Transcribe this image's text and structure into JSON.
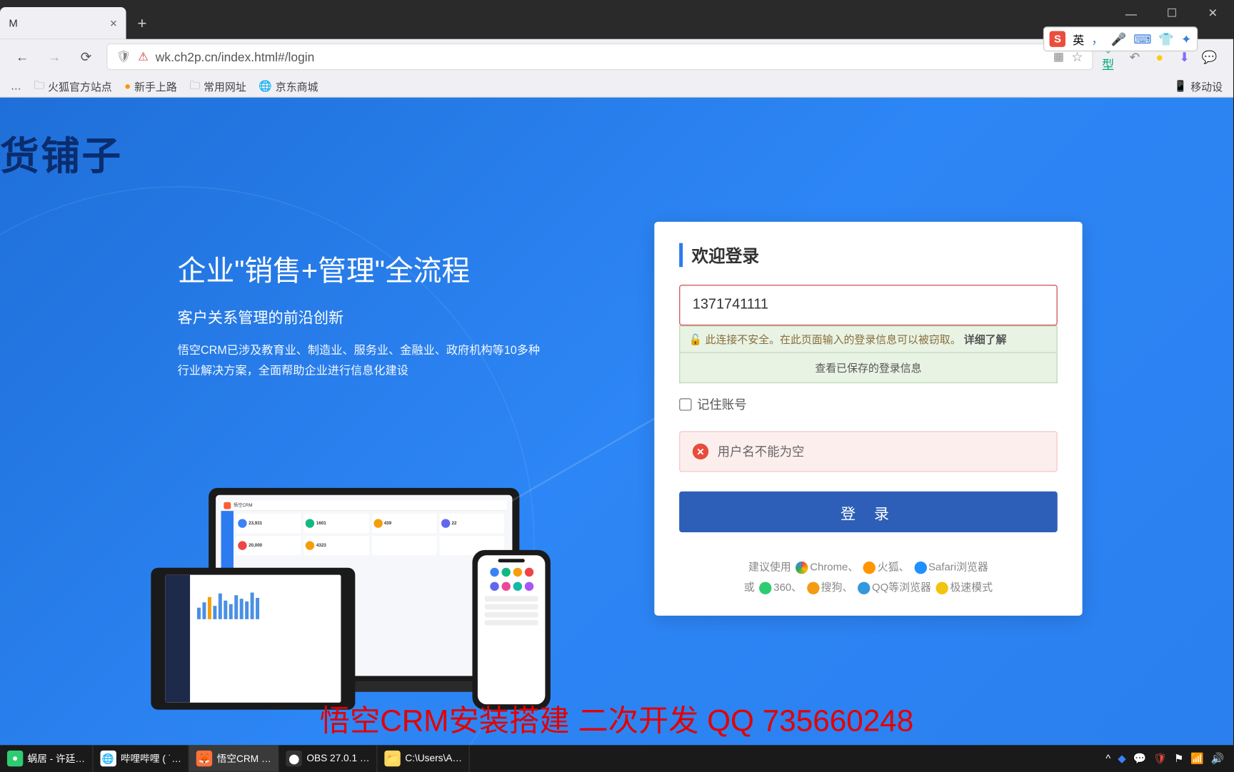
{
  "browser": {
    "tab_title": "M",
    "url": "wk.ch2p.cn/index.html#/login",
    "bookmarks": [
      "火狐官方站点",
      "新手上路",
      "常用网址",
      "京东商城"
    ],
    "mobile_bookmark": "移动设"
  },
  "ime": {
    "lang": "英"
  },
  "brand": "货铺子",
  "hero": {
    "title": "企业\"销售+管理\"全流程",
    "subtitle": "客户关系管理的前沿创新",
    "desc1": "悟空CRM已涉及教育业、制造业、服务业、金融业、政府机构等10多种",
    "desc2": "行业解决方案，全面帮助企业进行信息化建设"
  },
  "dashboard": {
    "product": "悟空CRM",
    "metrics": [
      "23,931",
      "1601",
      "439",
      "22",
      "20,000",
      "4323"
    ]
  },
  "login": {
    "title": "欢迎登录",
    "username_value": "1371741111",
    "security_warning": "此连接不安全。在此页面输入的登录信息可以被窃取。",
    "security_link": "详细了解",
    "saved_info": "查看已保存的登录信息",
    "remember_label": "记住账号",
    "error_msg": "用户名不能为空",
    "submit_label": "登 录",
    "rec_line1_a": "建议使用",
    "rec_chrome": "Chrome、",
    "rec_firefox": "火狐、",
    "rec_safari": "Safari浏览器",
    "rec_line2_a": "或",
    "rec_360": "360、",
    "rec_sogou": "搜狗、",
    "rec_qq": "QQ等浏览器",
    "rec_speed": "极速模式"
  },
  "overlay": "悟空CRM安装搭建 二次开发 QQ 735660248",
  "taskbar": {
    "items": [
      "蜗居 - 许廷…",
      "哔哩哔哩 ( ˙…",
      "悟空CRM …",
      "OBS 27.0.1 …",
      "C:\\Users\\A…"
    ]
  }
}
